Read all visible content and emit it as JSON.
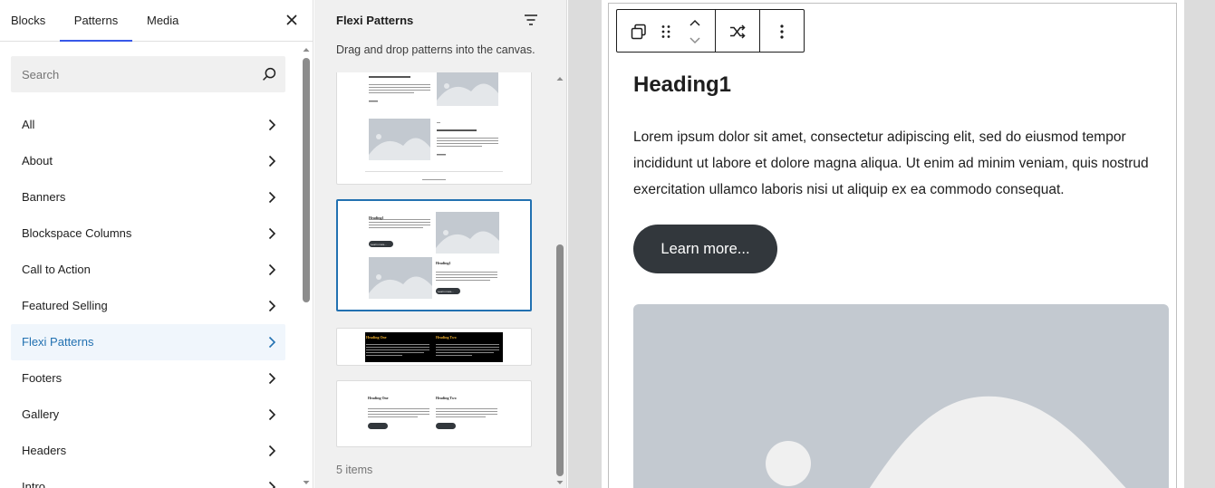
{
  "inserter": {
    "tabs": [
      "Blocks",
      "Patterns",
      "Media"
    ],
    "active_tab": "Patterns",
    "search": {
      "placeholder": "Search",
      "value": ""
    },
    "categories": [
      {
        "label": "All"
      },
      {
        "label": "About"
      },
      {
        "label": "Banners"
      },
      {
        "label": "Blockspace Columns"
      },
      {
        "label": "Call to Action"
      },
      {
        "label": "Featured Selling"
      },
      {
        "label": "Flexi Patterns",
        "active": true
      },
      {
        "label": "Footers"
      },
      {
        "label": "Gallery"
      },
      {
        "label": "Headers"
      },
      {
        "label": "Intro"
      }
    ]
  },
  "patterns_panel": {
    "title": "Flexi Patterns",
    "description": "Drag and drop patterns into the canvas.",
    "count_label": "5 items",
    "card2": {
      "heading": "Heading1",
      "button": "Learn more..."
    },
    "card3": {
      "heading_one": "Heading One",
      "heading_two": "Heading Two"
    },
    "card4": {
      "heading_one": "Heading One",
      "heading_two": "Heading Two"
    }
  },
  "canvas": {
    "heading": "Heading1",
    "paragraph": "Lorem ipsum dolor sit amet, consectetur adipiscing elit, sed do eiusmod tempor incididunt ut labore et dolore magna aliqua. Ut enim ad minim veniam, quis nostrud exercitation ullamco laboris nisi ut aliquip ex ea commodo consequat.",
    "button_label": "Learn more..."
  },
  "colors": {
    "accent": "#2271b1",
    "tab_indicator": "#3858e9",
    "button_dark": "#32373c",
    "placeholder_bg": "#c3c9d0",
    "heading_gold": "#f0b132"
  },
  "icons": [
    "close-icon",
    "search-icon",
    "chevron-right-icon",
    "filter-icon",
    "duplicate-icon",
    "drag-handle-icon",
    "move-up-icon",
    "move-down-icon",
    "shuffle-icon",
    "more-options-icon",
    "image-placeholder-icon"
  ]
}
